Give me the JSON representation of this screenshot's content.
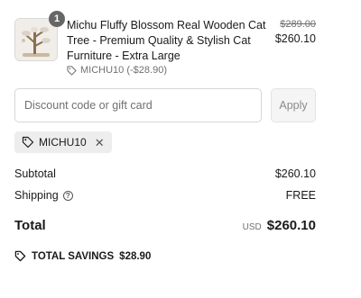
{
  "product": {
    "quantity": "1",
    "title": "Michu Fluffy Blossom Real Wooden Cat Tree - Premium Quality & Stylish Cat Furniture - Extra Large",
    "discount_line": "MICHU10 (-$28.90)",
    "price_original": "$289.00",
    "price_final": "$260.10",
    "image_icon": "cat-tree-image"
  },
  "discount": {
    "placeholder": "Discount code or gift card",
    "value": "",
    "apply_label": "Apply"
  },
  "applied_code": {
    "code": "MICHU10",
    "remove_icon": "close-icon"
  },
  "summary": {
    "subtotal_label": "Subtotal",
    "subtotal_value": "$260.10",
    "shipping_label": "Shipping",
    "shipping_value": "FREE",
    "total_label": "Total",
    "currency": "USD",
    "total_value": "$260.10"
  },
  "savings": {
    "label": "TOTAL SAVINGS",
    "value": "$28.90"
  },
  "colors": {
    "text": "#1a1a1a",
    "muted": "#707070",
    "badge": "#666666",
    "chip_bg": "#ededed",
    "button_bg": "#f5f5f5"
  }
}
